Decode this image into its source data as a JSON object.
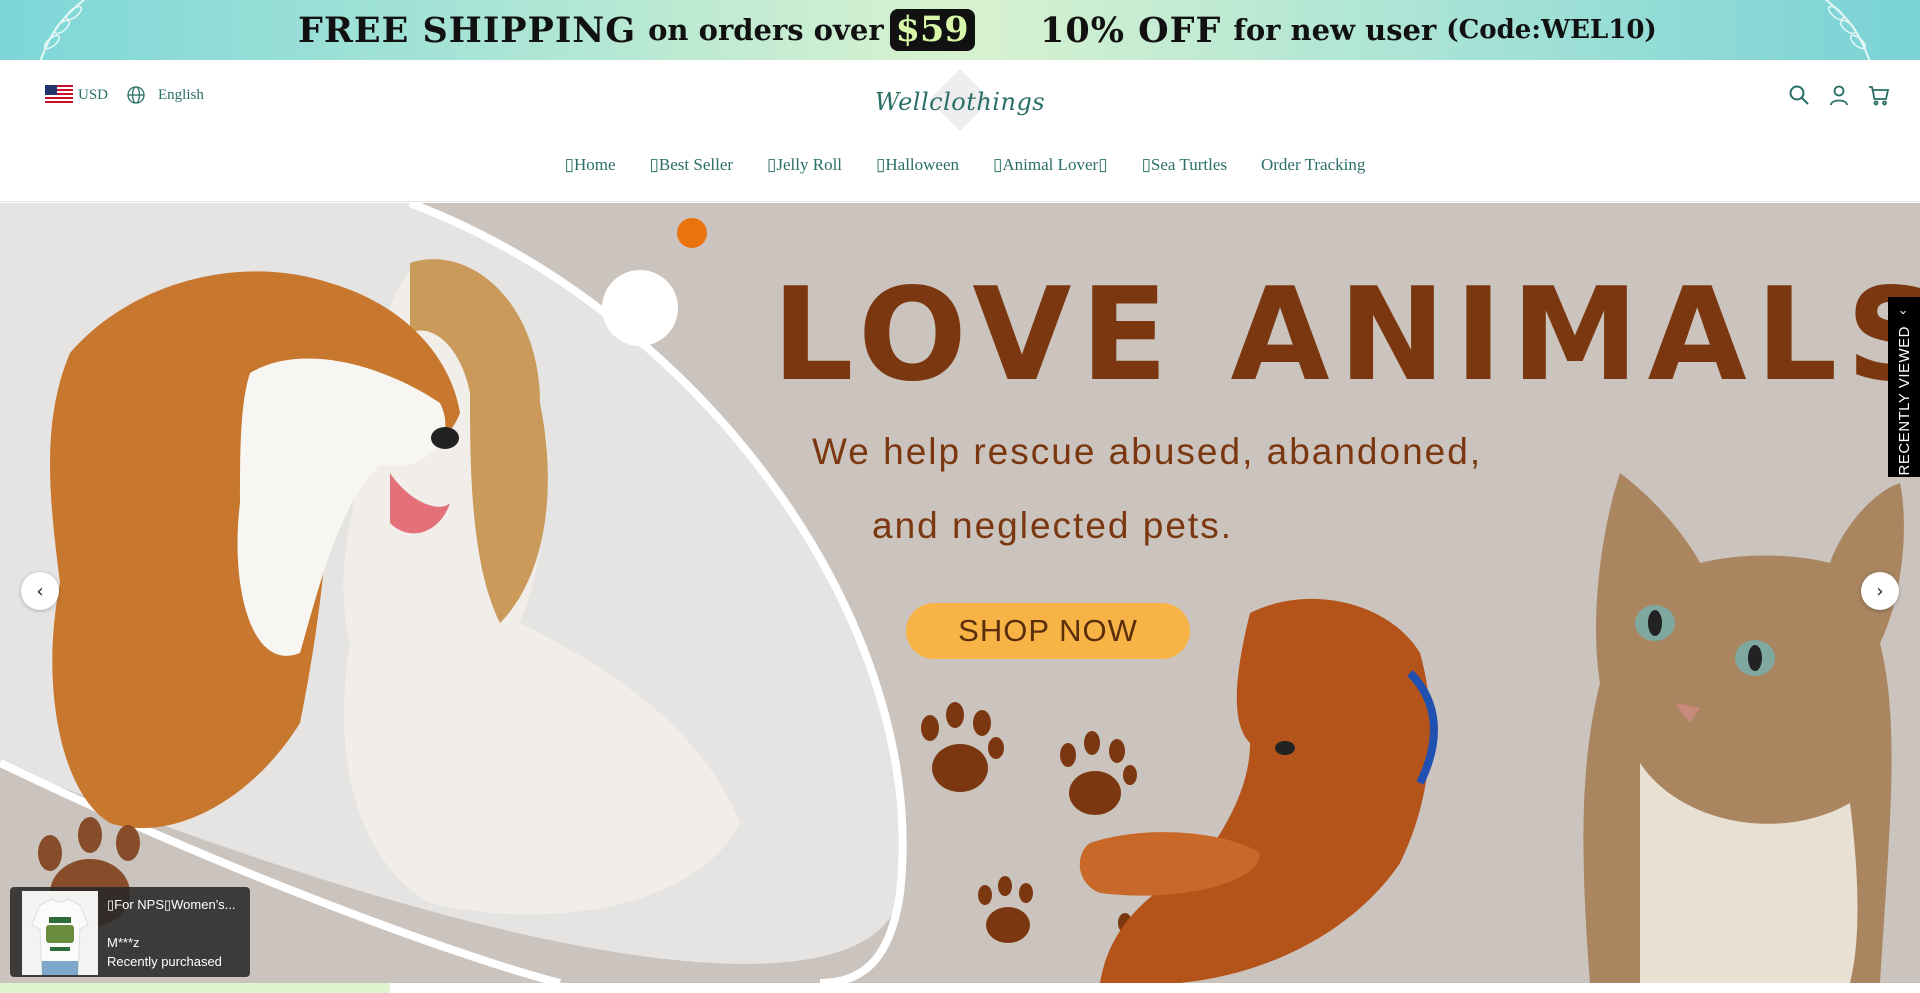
{
  "promo": {
    "shipping_strong": "FREE SHIPPING",
    "shipping_text": "on orders over",
    "shipping_price": "$59",
    "discount_strong": "10% OFF",
    "discount_text": "for new user",
    "discount_code": "(Code:WEL10)"
  },
  "header": {
    "currency": "USD",
    "language": "English",
    "logo_text": "Wellclothings",
    "icons": [
      "search-icon",
      "account-icon",
      "cart-icon"
    ]
  },
  "nav": {
    "items": [
      {
        "label": "▯Home"
      },
      {
        "label": "▯Best Seller"
      },
      {
        "label": "▯Jelly Roll"
      },
      {
        "label": "▯Halloween"
      },
      {
        "label": "▯Animal Lover▯"
      },
      {
        "label": "▯Sea Turtles"
      },
      {
        "label": "Order Tracking"
      }
    ]
  },
  "hero": {
    "title": "LOVE ANIMALS",
    "subtitle_line1": "We help rescue abused, abandoned,",
    "subtitle_line2": "and neglected pets.",
    "cta_label": "SHOP NOW",
    "prev_label": "‹",
    "next_label": "›"
  },
  "recently_viewed": {
    "label": "RECENTLY VIEWED",
    "chevron": "‹"
  },
  "purchase_popup": {
    "product": "▯For NPS▯Women's...",
    "buyer": "M***z",
    "status": "Recently purchased"
  },
  "colors": {
    "brand_green": "#2a6f67",
    "hero_brown": "#7b3810",
    "cta_orange": "#f8b346",
    "hero_bg": "#cfc7c1"
  }
}
